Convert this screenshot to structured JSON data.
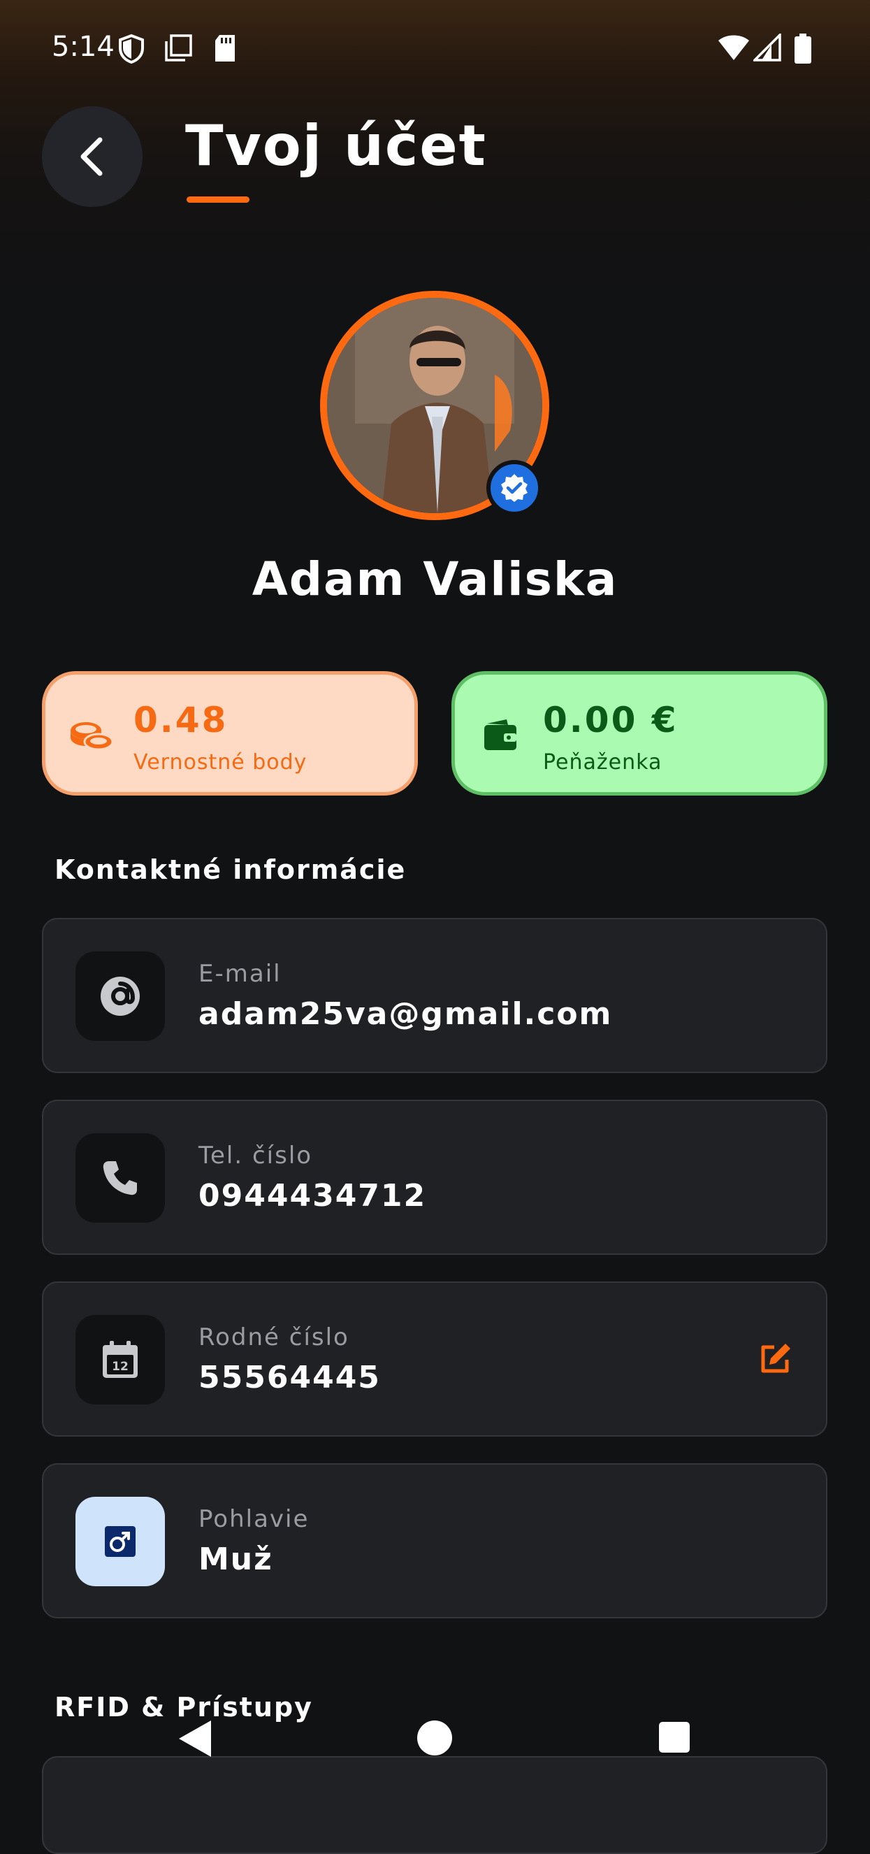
{
  "status_bar": {
    "time": "5:14"
  },
  "header": {
    "title": "Tvoj účet"
  },
  "profile": {
    "name": "Adam Valiska"
  },
  "stats": {
    "points": {
      "value": "0.48",
      "label": "Vernostné body",
      "color": "#f56a12"
    },
    "wallet": {
      "value": "0.00 €",
      "label": "Peňaženka",
      "color": "#0c5a17"
    }
  },
  "sections": {
    "contact_title": "Kontaktné informácie",
    "rfid_title": "RFID & Prístupy"
  },
  "contact": {
    "email": {
      "label": "E-mail",
      "value": "adam25va@gmail.com",
      "icon": "at-icon"
    },
    "phone": {
      "label": "Tel. číslo",
      "value": "0944434712",
      "icon": "phone-icon"
    },
    "birth": {
      "label": "Rodné číslo",
      "value": "55564445",
      "icon": "calendar-icon"
    },
    "gender": {
      "label": "Pohlavie",
      "value": "Muž",
      "icon": "male-icon"
    }
  },
  "colors": {
    "accent": "#ff6a10",
    "background": "#111214",
    "card": "#202125",
    "verified": "#1f6fe0"
  }
}
